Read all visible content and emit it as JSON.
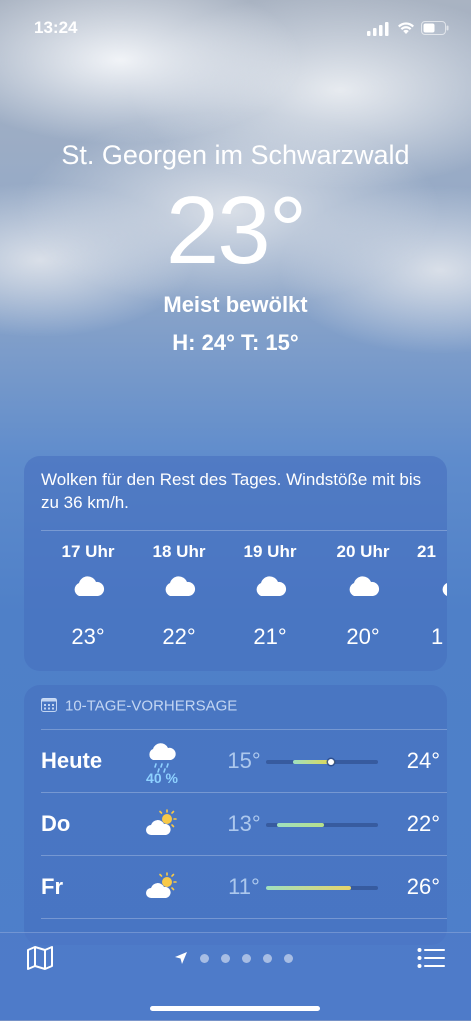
{
  "status_bar": {
    "time": "13:24"
  },
  "current": {
    "location": "St. Georgen im Schwarzwald",
    "temperature": "23°",
    "condition": "Meist bewölkt",
    "high_low": "H: 24°  T: 15°"
  },
  "hourly": {
    "summary": "Wolken für den Rest des Tages. Windstöße mit bis zu 36 km/h.",
    "hours": [
      {
        "time": "17 Uhr",
        "icon": "cloud-icon",
        "temp": "23°"
      },
      {
        "time": "18 Uhr",
        "icon": "cloud-icon",
        "temp": "22°"
      },
      {
        "time": "19 Uhr",
        "icon": "cloud-icon",
        "temp": "21°"
      },
      {
        "time": "20 Uhr",
        "icon": "cloud-icon",
        "temp": "20°"
      },
      {
        "time": "21",
        "icon": "cloud-icon",
        "temp": "1"
      }
    ]
  },
  "forecast": {
    "header": "10-TAGE-VORHERSAGE",
    "days": [
      {
        "day": "Heute",
        "icon": "rain-cloud-icon",
        "precip": "40 %",
        "low": "15°",
        "high": "24°",
        "range": [
          0.24,
          0.62
        ],
        "current": 0.58,
        "color": "#e6d84a"
      },
      {
        "day": "Do",
        "icon": "partly-sunny-icon",
        "precip": "",
        "low": "13°",
        "high": "22°",
        "range": [
          0.1,
          0.52
        ],
        "color": "#b7e08a"
      },
      {
        "day": "Fr",
        "icon": "partly-sunny-icon",
        "precip": "",
        "low": "11°",
        "high": "26°",
        "range": [
          0.0,
          0.76
        ],
        "color": "#e7d46a"
      }
    ]
  },
  "pager": {
    "pages": 5
  }
}
